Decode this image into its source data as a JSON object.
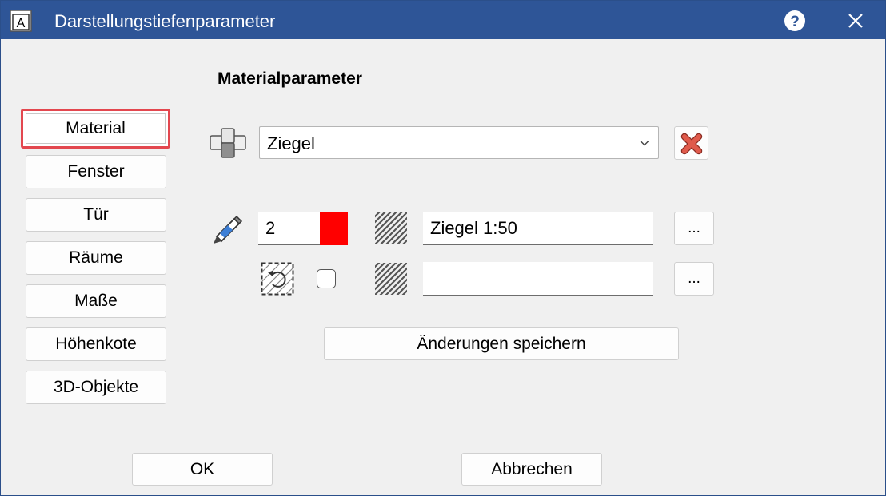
{
  "window": {
    "title": "Darstellungstiefenparameter",
    "app_icon_letter": "A"
  },
  "sidebar": {
    "items": [
      {
        "label": "Material",
        "selected": true
      },
      {
        "label": "Fenster"
      },
      {
        "label": "Tür"
      },
      {
        "label": "Räume"
      },
      {
        "label": "Maße"
      },
      {
        "label": "Höhenkote"
      },
      {
        "label": "3D-Objekte"
      }
    ]
  },
  "main": {
    "section_title": "Materialparameter",
    "material_select": {
      "value": "Ziegel"
    },
    "pen": {
      "value": "2",
      "color": "#ff0000"
    },
    "hatch_primary": {
      "value": "Ziegel 1:50"
    },
    "hatch_secondary": {
      "value": ""
    },
    "browse_label": "...",
    "save_changes_label": "Änderungen speichern",
    "rotate_checkbox_checked": false
  },
  "footer": {
    "ok_label": "OK",
    "cancel_label": "Abbrechen"
  },
  "colors": {
    "titlebar": "#2e5597",
    "highlight": "#e3474f",
    "delete": "#e05a4b"
  }
}
